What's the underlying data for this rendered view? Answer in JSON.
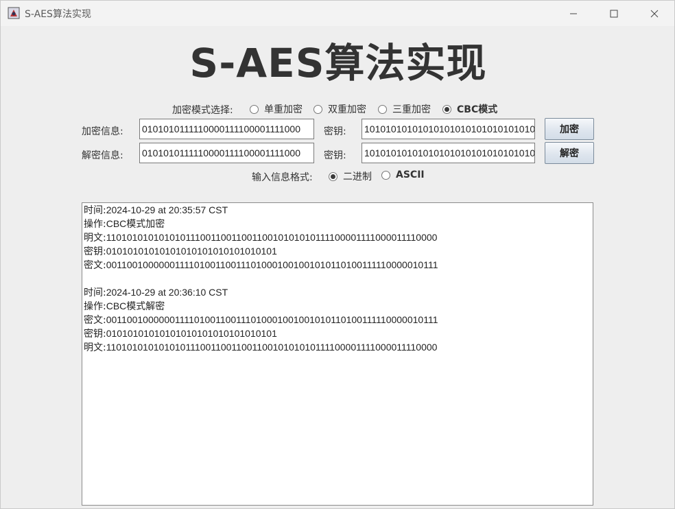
{
  "window": {
    "title": "S-AES算法实现",
    "controls": [
      "minimize-icon",
      "maximize-icon",
      "close-icon"
    ]
  },
  "heading": "S-AES算法实现",
  "mode": {
    "label": "加密模式选择:",
    "options": [
      {
        "label": "单重加密",
        "selected": false
      },
      {
        "label": "双重加密",
        "selected": false
      },
      {
        "label": "三重加密",
        "selected": false
      },
      {
        "label": "CBC模式",
        "selected": true
      }
    ]
  },
  "encrypt_row": {
    "label": "加密信息:",
    "value": "0101010111110000111100001111000",
    "key_label": "密钥:",
    "key_value": "10101010101010101010101010101010",
    "button": "加密"
  },
  "decrypt_row": {
    "label": "解密信息:",
    "value": "0101010111110000111100001111000",
    "key_label": "密钥:",
    "key_value": "10101010101010101010101010101010",
    "button": "解密"
  },
  "format": {
    "label": "输入信息格式:",
    "options": [
      {
        "label": "二进制",
        "selected": true
      },
      {
        "label": "ASCII",
        "selected": false
      }
    ]
  },
  "log": [
    {
      "k": "时间:",
      "v": "2024-10-29 at 20:35:57 CST"
    },
    {
      "k": "操作:",
      "v": "CBC模式加密"
    },
    {
      "k": "明文:",
      "v": "1101010101010101110011001100110010101010111100001111000011110000"
    },
    {
      "k": "密钥:",
      "v": "01010101010101010101010101010101"
    },
    {
      "k": "密文:",
      "v": "0011001000000111101001100111010001001001010110100111110000010111"
    },
    {
      "k": "",
      "v": ""
    },
    {
      "k": "时间:",
      "v": "2024-10-29 at 20:36:10 CST"
    },
    {
      "k": "操作:",
      "v": "CBC模式解密"
    },
    {
      "k": "密文:",
      "v": "0011001000000111101001100111010001001001010110100111110000010111"
    },
    {
      "k": "密钥:",
      "v": "01010101010101010101010101010101"
    },
    {
      "k": "明文:",
      "v": "1101010101010101110011001100110010101010111100001111000011110000"
    }
  ]
}
